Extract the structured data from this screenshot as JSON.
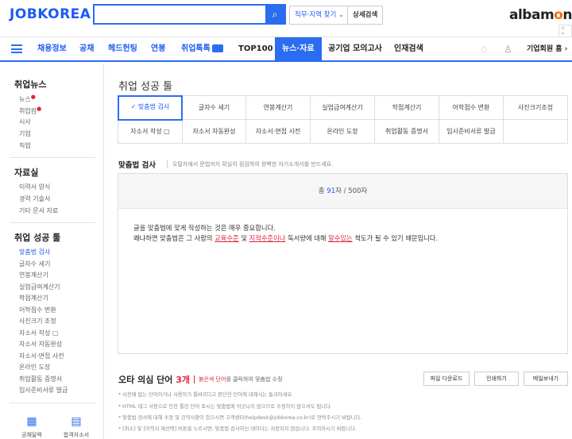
{
  "header": {
    "logo": "JOBKOREA",
    "search": {
      "value": "",
      "placeholder": ""
    },
    "search_icon": "search-icon",
    "region_button": "직무·지역 찾기 ⌄",
    "detail_button": "상세검색",
    "partner_logo": {
      "left": "albam",
      "mid": "o",
      "right": "n"
    },
    "mini_arrows": "< >"
  },
  "nav": {
    "items": [
      "채용정보",
      "공채",
      "헤드헌팅",
      "연봉",
      "취업톡톡",
      "TOP100",
      "뉴스·자료",
      "공기업 모의고사",
      "인재검색"
    ],
    "corporate_home": "기업회원 홈 ›"
  },
  "sidebar": {
    "news": {
      "title": "취업뉴스",
      "items": [
        "뉴스",
        "취업컴",
        "시사",
        "기업",
        "직업"
      ]
    },
    "resources": {
      "title": "자료실",
      "items": [
        "이력서 양식",
        "경력 기술서",
        "기타 문서 자료"
      ]
    },
    "tools": {
      "title": "취업 성공 툴",
      "items": [
        "맞춤법 검사",
        "글자수 세기",
        "연봉계산기",
        "실업급여계산기",
        "학점계산기",
        "어학점수 변환",
        "사진크기 조정",
        "자소서 작성 ▢",
        "자소서 자동완성",
        "자소서·면접 사전",
        "온라인 도장",
        "취업활동 증명서",
        "입사준비서류 발급"
      ]
    },
    "bottom": [
      "공채달력",
      "합격자소서"
    ]
  },
  "main": {
    "title": "취업 성공 툴",
    "tabs_row1": [
      "✓ 맞춤법 검사",
      "글자수 세기",
      "연봉계산기",
      "실업급여계산기",
      "학점계산기",
      "어학점수 변환",
      "사진크기조정"
    ],
    "tabs_row2": [
      "자소서 작성 ▢",
      "자소서 자동완성",
      "자소서·면접 사전",
      "온라인 도장",
      "취업활동 증명서",
      "입사준비서류 발급"
    ],
    "spell": {
      "title": "맞춤법 검사",
      "desc": "오탈자에서 문법까지 확실히 점검하여 완벽한 자기소개서를 만드세요.",
      "count_prefix": "총 ",
      "count_value": "91",
      "count_suffix": "자 / 500자",
      "line1": "글을 맞춤법에 맞게 작성하는 것은 매우 중요합니다.",
      "line2": {
        "a": "왜냐하면 맞춤법은 그 사람의 ",
        "e1": "교육수준",
        "b": " 및 ",
        "e2": "지적수준이나",
        "c": " 독서량에 대해 ",
        "e3": "알수있는",
        "d": " 척도가 될 수 있기 때문입니다."
      }
    },
    "doubt": {
      "title": "오타 의심 단어 ",
      "count": "3개",
      "hint_red": "붉은색 단어",
      "hint_rest": "를 클릭하여 맞춤법 수정",
      "buttons": [
        "파일 다운로드",
        "인쇄하기",
        "메일보내기"
      ],
      "notes": [
        "* 사전에 없는 단어이거나 사용자가 틀바르다고 판단한 단어에 대해서는 통과하세요.",
        "* HTML 태그 사용으로 인한 틀린 단어 표시는 맞춤법에 어긋나지 않으므로 수정하지 않으셔도 됩니다.",
        "* 맞춤법 검사에 대해 수정 및 건의사항이 있으시면 고객센터(helpdesk@jobkorea.co.kr)로 연락주시기 바랍니다.",
        "* [취소] 및 [이력서 재선택] 버튼을 누르시면, 맞춤법 검사하신 데이터는 저장되지 않습니다. 주의하시기 바랍니다."
      ]
    }
  },
  "colors": {
    "brand_blue": "#2b6df0",
    "error_red": "#e0263b",
    "albamon_orange": "#ff6a00"
  }
}
